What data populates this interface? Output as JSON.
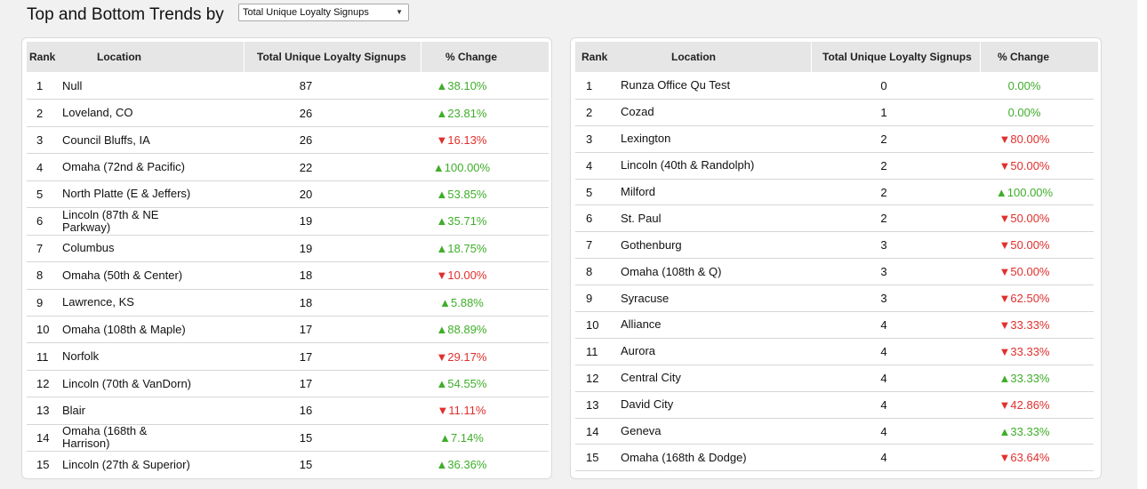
{
  "header": {
    "title": "Top and Bottom Trends by",
    "metric_select": {
      "selected": "Total Unique Loyalty Signups"
    }
  },
  "colors": {
    "up": "#3fae2a",
    "down": "#e0302d",
    "header_bg": "#e6e6e6"
  },
  "columns": {
    "rank": "Rank",
    "location": "Location",
    "value": "Total Unique Loyalty Signups",
    "change": "% Change"
  },
  "top_table": {
    "rows": [
      {
        "rank": "1",
        "location": "Null",
        "value": "87",
        "arrow": "▲",
        "change": "38.10%",
        "dir": "up"
      },
      {
        "rank": "2",
        "location": "Loveland, CO",
        "value": "26",
        "arrow": "▲",
        "change": "23.81%",
        "dir": "up"
      },
      {
        "rank": "3",
        "location": "Council Bluffs, IA",
        "value": "26",
        "arrow": "▼",
        "change": "16.13%",
        "dir": "down"
      },
      {
        "rank": "4",
        "location": "Omaha (72nd & Pacific)",
        "value": "22",
        "arrow": "▲",
        "change": "100.00%",
        "dir": "up"
      },
      {
        "rank": "5",
        "location": "North Platte (E & Jeffers)",
        "value": "20",
        "arrow": "▲",
        "change": "53.85%",
        "dir": "up"
      },
      {
        "rank": "6",
        "location": "Lincoln (87th & NE Parkway)",
        "value": "19",
        "arrow": "▲",
        "change": "35.71%",
        "dir": "up"
      },
      {
        "rank": "7",
        "location": "Columbus",
        "value": "19",
        "arrow": "▲",
        "change": "18.75%",
        "dir": "up"
      },
      {
        "rank": "8",
        "location": "Omaha (50th & Center)",
        "value": "18",
        "arrow": "▼",
        "change": "10.00%",
        "dir": "down"
      },
      {
        "rank": "9",
        "location": "Lawrence, KS",
        "value": "18",
        "arrow": "▲",
        "change": "5.88%",
        "dir": "up"
      },
      {
        "rank": "10",
        "location": "Omaha (108th & Maple)",
        "value": "17",
        "arrow": "▲",
        "change": "88.89%",
        "dir": "up"
      },
      {
        "rank": "11",
        "location": "Norfolk",
        "value": "17",
        "arrow": "▼",
        "change": "29.17%",
        "dir": "down"
      },
      {
        "rank": "12",
        "location": "Lincoln (70th & VanDorn)",
        "value": "17",
        "arrow": "▲",
        "change": "54.55%",
        "dir": "up"
      },
      {
        "rank": "13",
        "location": "Blair",
        "value": "16",
        "arrow": "▼",
        "change": "11.11%",
        "dir": "down"
      },
      {
        "rank": "14",
        "location": "Omaha (168th & Harrison)",
        "value": "15",
        "arrow": "▲",
        "change": "7.14%",
        "dir": "up"
      },
      {
        "rank": "15",
        "location": "Lincoln (27th & Superior)",
        "value": "15",
        "arrow": "▲",
        "change": "36.36%",
        "dir": "up"
      }
    ]
  },
  "bottom_table": {
    "rows": [
      {
        "rank": "1",
        "location": "Runza Office Qu Test",
        "value": "0",
        "arrow": "",
        "change": "0.00%",
        "dir": "flat"
      },
      {
        "rank": "2",
        "location": "Cozad",
        "value": "1",
        "arrow": "",
        "change": "0.00%",
        "dir": "flat"
      },
      {
        "rank": "3",
        "location": "Lexington",
        "value": "2",
        "arrow": "▼",
        "change": "80.00%",
        "dir": "down"
      },
      {
        "rank": "4",
        "location": "Lincoln (40th & Randolph)",
        "value": "2",
        "arrow": "▼",
        "change": "50.00%",
        "dir": "down"
      },
      {
        "rank": "5",
        "location": "Milford",
        "value": "2",
        "arrow": "▲",
        "change": "100.00%",
        "dir": "up"
      },
      {
        "rank": "6",
        "location": "St. Paul",
        "value": "2",
        "arrow": "▼",
        "change": "50.00%",
        "dir": "down"
      },
      {
        "rank": "7",
        "location": "Gothenburg",
        "value": "3",
        "arrow": "▼",
        "change": "50.00%",
        "dir": "down"
      },
      {
        "rank": "8",
        "location": "Omaha (108th & Q)",
        "value": "3",
        "arrow": "▼",
        "change": "50.00%",
        "dir": "down"
      },
      {
        "rank": "9",
        "location": "Syracuse",
        "value": "3",
        "arrow": "▼",
        "change": "62.50%",
        "dir": "down"
      },
      {
        "rank": "10",
        "location": "Alliance",
        "value": "4",
        "arrow": "▼",
        "change": "33.33%",
        "dir": "down"
      },
      {
        "rank": "11",
        "location": "Aurora",
        "value": "4",
        "arrow": "▼",
        "change": "33.33%",
        "dir": "down"
      },
      {
        "rank": "12",
        "location": "Central City",
        "value": "4",
        "arrow": "▲",
        "change": "33.33%",
        "dir": "up"
      },
      {
        "rank": "13",
        "location": "David City",
        "value": "4",
        "arrow": "▼",
        "change": "42.86%",
        "dir": "down"
      },
      {
        "rank": "14",
        "location": "Geneva",
        "value": "4",
        "arrow": "▲",
        "change": "33.33%",
        "dir": "up"
      },
      {
        "rank": "15",
        "location": "Omaha (168th & Dodge)",
        "value": "4",
        "arrow": "▼",
        "change": "63.64%",
        "dir": "down"
      }
    ]
  }
}
